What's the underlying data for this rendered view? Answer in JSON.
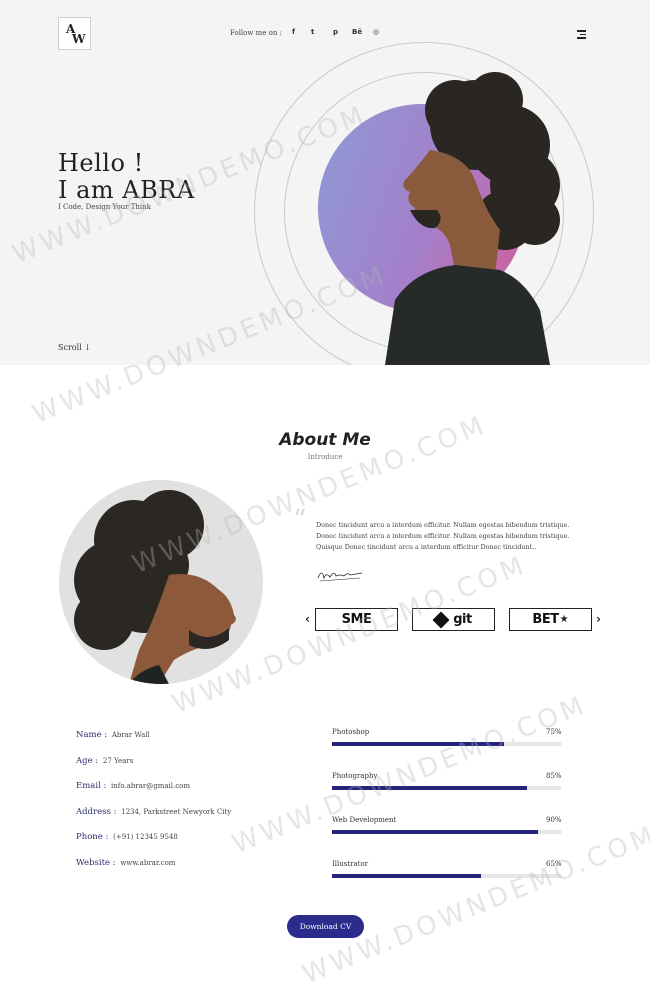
{
  "header": {
    "logo_top": "A",
    "logo_bottom": "W",
    "follow_label": "Follow me on :",
    "social": [
      "f",
      "t",
      "p",
      "Bē",
      "◎"
    ]
  },
  "hero": {
    "line1": "Hello !",
    "line2": "I am ABRA",
    "tagline": "I Code, Design Your Think",
    "scroll": "Scroll ↓"
  },
  "about": {
    "title": "About Me",
    "subtitle": "Introduce",
    "quote": "Donec tincidunt arcu a interdum efficitur. Nullam egestas bibendum tristique. Donec tincidunt arcu a interdum efficitur. Nullam egestas bibendum tristique. Quisque Donec tincidunt arcu a interdum efficitur Donec tincidunt..",
    "brands": [
      "SME",
      "git",
      "BET"
    ],
    "prev_arrow": "‹",
    "next_arrow": "›"
  },
  "info": [
    {
      "label": "Name :",
      "value": "Abrar Wall"
    },
    {
      "label": "Age :",
      "value": "27 Years"
    },
    {
      "label": "Email :",
      "value": "info.abrar@gmail.com"
    },
    {
      "label": "Address :",
      "value": "1234, Parkstreet Newyork City"
    },
    {
      "label": "Phone :",
      "value": "(+91) 12345 9548"
    },
    {
      "label": "Website :",
      "value": "www.abrar.com"
    }
  ],
  "skills": [
    {
      "name": "Photoshop",
      "pct_label": "75%",
      "value": 0.75
    },
    {
      "name": "Photography",
      "pct_label": "85%",
      "value": 0.85
    },
    {
      "name": "Web Development",
      "pct_label": "90%",
      "value": 0.9
    },
    {
      "name": "Illustrator",
      "pct_label": "65%",
      "value": 0.65
    }
  ],
  "cta": {
    "download": "Download CV"
  },
  "watermark": "WWW.DOWNDEMO.COM",
  "colors": {
    "accent": "#2b2c8c",
    "skill_fill": "#23247a",
    "hero_bg": "#f4f4f4"
  }
}
